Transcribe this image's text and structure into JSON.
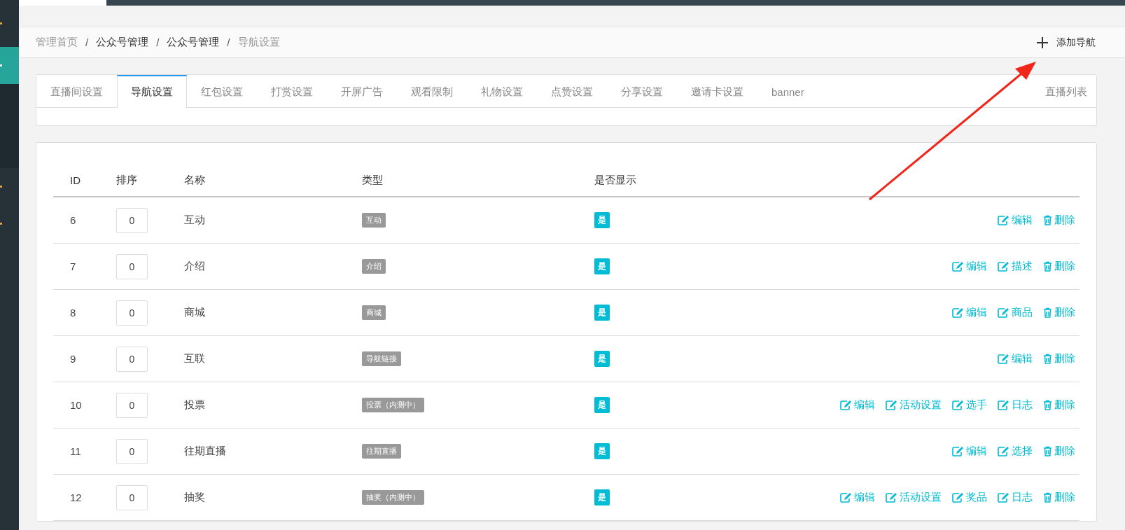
{
  "sidebar": {
    "items": [
      {
        "selected": false
      },
      {
        "selected": true
      },
      {
        "selected": false
      },
      {
        "selected": false
      },
      {
        "selected": false
      }
    ]
  },
  "breadcrumb": {
    "separator": "/",
    "items": [
      {
        "label": "管理首页",
        "link": false
      },
      {
        "label": "公众号管理",
        "link": true
      },
      {
        "label": "公众号管理",
        "link": true
      },
      {
        "label": "导航设置",
        "link": false
      }
    ]
  },
  "add_button": {
    "label": "添加导航"
  },
  "tabs": [
    {
      "label": "直播间设置",
      "selected": false
    },
    {
      "label": "导航设置",
      "selected": true
    },
    {
      "label": "红包设置",
      "selected": false
    },
    {
      "label": "打赏设置",
      "selected": false
    },
    {
      "label": "开屏广告",
      "selected": false
    },
    {
      "label": "观看限制",
      "selected": false
    },
    {
      "label": "礼物设置",
      "selected": false
    },
    {
      "label": "点赞设置",
      "selected": false
    },
    {
      "label": "分享设置",
      "selected": false
    },
    {
      "label": "邀请卡设置",
      "selected": false
    },
    {
      "label": "banner",
      "selected": false
    }
  ],
  "right_tab": {
    "label": "直播列表"
  },
  "table": {
    "columns": [
      "ID",
      "排序",
      "名称",
      "类型",
      "是否显示"
    ],
    "rows": [
      {
        "id": "6",
        "sort": "0",
        "name": "互动",
        "type": "互动",
        "shown": "是",
        "actions": [
          {
            "kind": "edit",
            "label": "编辑"
          },
          {
            "kind": "delete",
            "label": "删除"
          }
        ]
      },
      {
        "id": "7",
        "sort": "0",
        "name": "介绍",
        "type": "介绍",
        "shown": "是",
        "actions": [
          {
            "kind": "edit",
            "label": "编辑"
          },
          {
            "kind": "edit",
            "label": "描述"
          },
          {
            "kind": "delete",
            "label": "删除"
          }
        ]
      },
      {
        "id": "8",
        "sort": "0",
        "name": "商城",
        "type": "商城",
        "shown": "是",
        "actions": [
          {
            "kind": "edit",
            "label": "编辑"
          },
          {
            "kind": "edit",
            "label": "商品"
          },
          {
            "kind": "delete",
            "label": "删除"
          }
        ]
      },
      {
        "id": "9",
        "sort": "0",
        "name": "互联",
        "type": "导航链接",
        "shown": "是",
        "actions": [
          {
            "kind": "edit",
            "label": "编辑"
          },
          {
            "kind": "delete",
            "label": "删除"
          }
        ]
      },
      {
        "id": "10",
        "sort": "0",
        "name": "投票",
        "type": "投票（内测中）",
        "shown": "是",
        "actions": [
          {
            "kind": "edit",
            "label": "编辑"
          },
          {
            "kind": "edit",
            "label": "活动设置"
          },
          {
            "kind": "edit",
            "label": "选手"
          },
          {
            "kind": "edit",
            "label": "日志"
          },
          {
            "kind": "delete",
            "label": "删除"
          }
        ]
      },
      {
        "id": "11",
        "sort": "0",
        "name": "往期直播",
        "type": "往期直播",
        "shown": "是",
        "actions": [
          {
            "kind": "edit",
            "label": "编辑"
          },
          {
            "kind": "edit",
            "label": "选择"
          },
          {
            "kind": "delete",
            "label": "删除"
          }
        ]
      },
      {
        "id": "12",
        "sort": "0",
        "name": "抽奖",
        "type": "抽奖（内测中）",
        "shown": "是",
        "actions": [
          {
            "kind": "edit",
            "label": "编辑"
          },
          {
            "kind": "edit",
            "label": "活动设置"
          },
          {
            "kind": "edit",
            "label": "奖品"
          },
          {
            "kind": "edit",
            "label": "日志"
          },
          {
            "kind": "delete",
            "label": "删除"
          }
        ]
      }
    ]
  }
}
